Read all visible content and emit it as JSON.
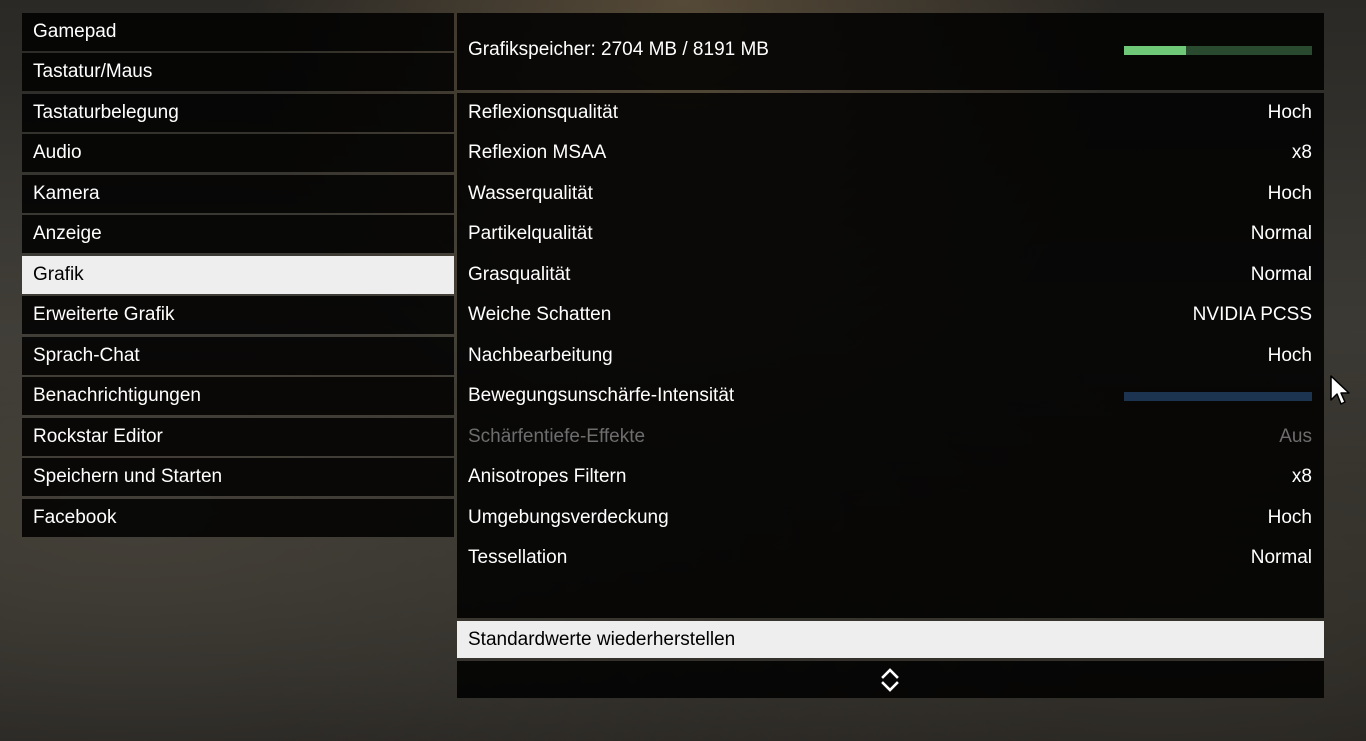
{
  "menu": {
    "items": [
      {
        "label": "Gamepad",
        "active": false
      },
      {
        "label": "Tastatur/Maus",
        "active": false
      },
      {
        "label": "Tastaturbelegung",
        "active": false
      },
      {
        "label": "Audio",
        "active": false
      },
      {
        "label": "Kamera",
        "active": false
      },
      {
        "label": "Anzeige",
        "active": false
      },
      {
        "label": "Grafik",
        "active": true
      },
      {
        "label": "Erweiterte Grafik",
        "active": false
      },
      {
        "label": "Sprach-Chat",
        "active": false
      },
      {
        "label": "Benachrichtigungen",
        "active": false
      },
      {
        "label": "Rockstar Editor",
        "active": false
      },
      {
        "label": "Speichern und Starten",
        "active": false
      },
      {
        "label": "Facebook",
        "active": false
      }
    ]
  },
  "header": {
    "vram_label": "Grafikspeicher: 2704 MB / 8191 MB",
    "vram_usage_fraction": 0.33,
    "vram_fill_color": "#6fc877",
    "vram_track_color": "#2a4a30"
  },
  "settings": [
    {
      "label": "Reflexionsqualität",
      "value": "Hoch"
    },
    {
      "label": "Reflexion MSAA",
      "value": "x8"
    },
    {
      "label": "Wasserqualität",
      "value": "Hoch"
    },
    {
      "label": "Partikelqualität",
      "value": "Normal"
    },
    {
      "label": "Grasqualität",
      "value": "Normal"
    },
    {
      "label": "Weiche Schatten",
      "value": "NVIDIA PCSS"
    },
    {
      "label": "Nachbearbeitung",
      "value": "Hoch"
    },
    {
      "label": "Bewegungsunschärfe-Intensität",
      "value": null,
      "slider_fraction": 0.0,
      "slider_color": "#1d3450"
    },
    {
      "label": "Schärfentiefe-Effekte",
      "value": "Aus",
      "disabled": true
    },
    {
      "label": "Anisotropes Filtern",
      "value": "x8"
    },
    {
      "label": "Umgebungsverdeckung",
      "value": "Hoch"
    },
    {
      "label": "Tessellation",
      "value": "Normal"
    }
  ],
  "reset_label": "Standardwerte wiederherstellen",
  "icons": {
    "scroll": "up-down-chevron-icon",
    "cursor": "mouse-pointer-icon"
  }
}
